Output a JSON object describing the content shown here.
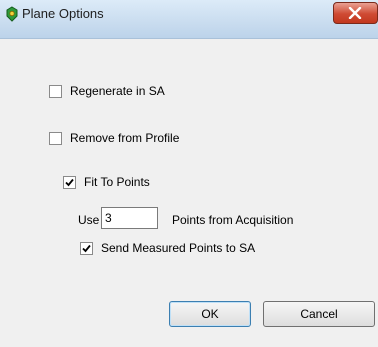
{
  "window": {
    "title": "Plane Options",
    "close_icon": "close-x-icon",
    "app_icon": "plane-app-icon"
  },
  "options": {
    "regenerate": {
      "label": "Regenerate in SA",
      "checked": false
    },
    "remove_profile": {
      "label": "Remove from Profile",
      "checked": false
    },
    "fit_to_points": {
      "label": "Fit To Points",
      "checked": true
    },
    "use_label": "Use",
    "points_value": "3",
    "points_suffix": "Points from Acquisition",
    "send_measured": {
      "label": "Send Measured Points to SA",
      "checked": true
    }
  },
  "buttons": {
    "ok": "OK",
    "cancel": "Cancel"
  },
  "colors": {
    "title_bar": "#c9dcef",
    "close_button": "#cf4a33",
    "dialog_bg": "#f0f0f0"
  }
}
